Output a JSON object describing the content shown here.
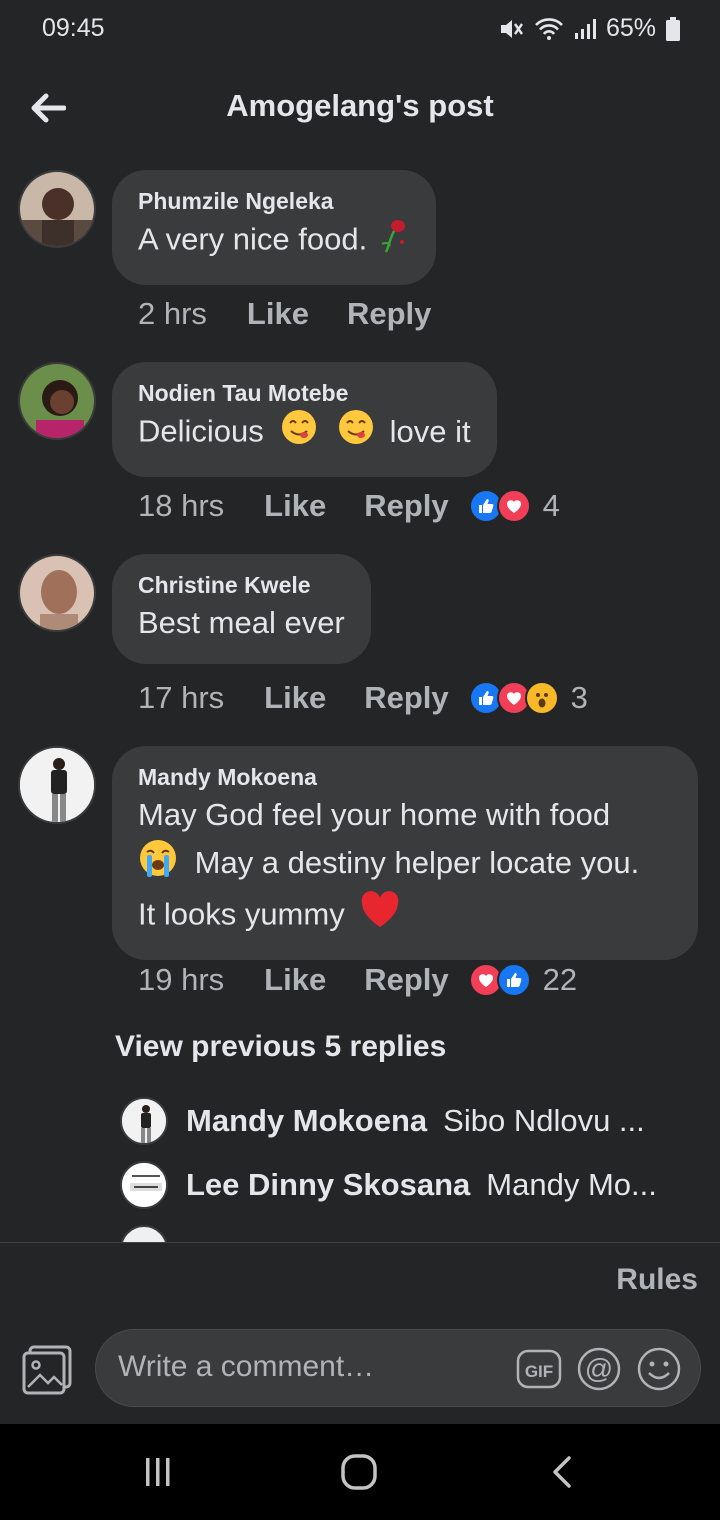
{
  "status": {
    "time": "09:45",
    "battery": "65%"
  },
  "header": {
    "title": "Amogelang's post"
  },
  "comments": [
    {
      "author": "Phumzile Ngeleka",
      "text": "A very nice food.",
      "time": "2 hrs",
      "like": "Like",
      "reply": "Reply",
      "reaction_count": ""
    },
    {
      "author": "Nodien Tau Motebe",
      "text_a": "Delicious",
      "text_b": "love it",
      "time": "18 hrs",
      "like": "Like",
      "reply": "Reply",
      "reaction_count": "4"
    },
    {
      "author": "Christine Kwele",
      "text": "Best meal ever",
      "time": "17 hrs",
      "like": "Like",
      "reply": "Reply",
      "reaction_count": "3"
    },
    {
      "author": "Mandy Mokoena",
      "line1": "May God feel your home with food",
      "line2": "May a destiny helper locate you.",
      "line3": "It looks yummy",
      "time": "19 hrs",
      "like": "Like",
      "reply": "Reply",
      "reaction_count": "22"
    }
  ],
  "replies": {
    "view_previous": "View previous 5 replies",
    "items": [
      {
        "author": "Mandy Mokoena",
        "text": "Sibo Ndlovu ..."
      },
      {
        "author": "Lee Dinny Skosana",
        "text": "Mandy Mo..."
      }
    ]
  },
  "composer": {
    "rules": "Rules",
    "placeholder": "Write a comment…"
  },
  "icons": {
    "back": "arrow-left-icon",
    "photo": "photo-icon",
    "gif": "gif-icon",
    "mention": "at-icon",
    "emoji": "smiley-icon"
  },
  "colors": {
    "background": "#242526",
    "bubble": "#3a3b3c",
    "like_blue": "#1877f2",
    "love_red": "#f33e58"
  }
}
